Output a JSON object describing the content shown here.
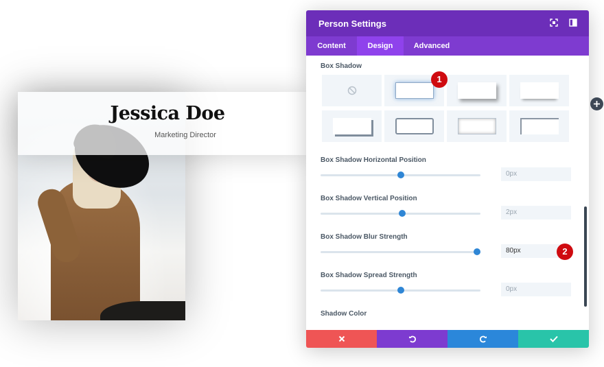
{
  "preview": {
    "name": "Jessica Doe",
    "position": "Marketing Director"
  },
  "modal": {
    "title": "Person Settings",
    "tabs": [
      {
        "label": "Content",
        "active": false
      },
      {
        "label": "Design",
        "active": true
      },
      {
        "label": "Advanced",
        "active": false
      }
    ],
    "box_shadow": {
      "label": "Box Shadow",
      "presets": [
        "none",
        "preset-1",
        "preset-2",
        "preset-3",
        "preset-4",
        "preset-5",
        "preset-6",
        "preset-7"
      ],
      "selected_index": 1
    },
    "settings": [
      {
        "label": "Box Shadow Horizontal Position",
        "value": "0px",
        "slider_fraction": 0.5
      },
      {
        "label": "Box Shadow Vertical Position",
        "value": "2px",
        "slider_fraction": 0.51
      },
      {
        "label": "Box Shadow Blur Strength",
        "value": "80px",
        "slider_fraction": 0.98,
        "active": true
      },
      {
        "label": "Box Shadow Spread Strength",
        "value": "0px",
        "slider_fraction": 0.5
      }
    ],
    "shadow_color_label": "Shadow Color",
    "footer": {
      "cancel_icon": "close-icon",
      "undo_icon": "undo-icon",
      "redo_icon": "redo-icon",
      "save_icon": "check-icon"
    }
  },
  "annotations": {
    "badge1": "1",
    "badge2": "2"
  },
  "colors": {
    "header": "#6c2eb9",
    "tabbar": "#7e3bd0",
    "active_tab": "#8f42ec",
    "slider_knob": "#2f86d5",
    "cancel": "#ef5555",
    "undo": "#7d3bd0",
    "redo": "#2b87da",
    "save": "#29c4a9",
    "badge": "#cf0b10"
  }
}
